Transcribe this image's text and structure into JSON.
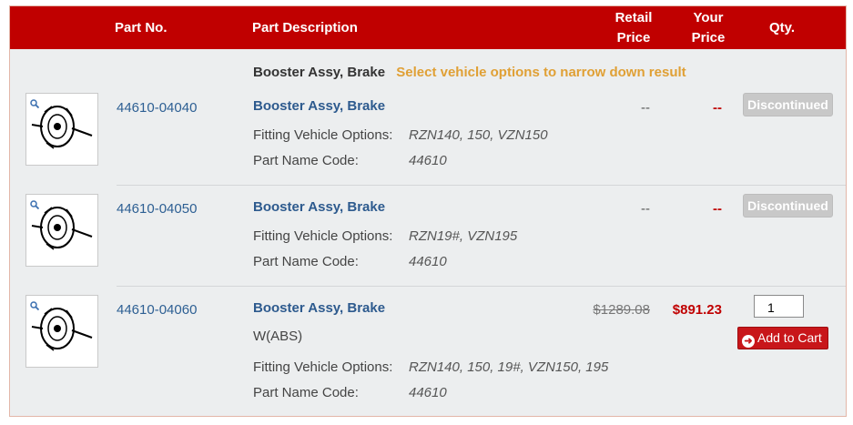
{
  "header": {
    "part_no": "Part No.",
    "part_description": "Part Description",
    "retail_price_l1": "Retail",
    "retail_price_l2": "Price",
    "your_price_l1": "Your",
    "your_price_l2": "Price",
    "qty": "Qty."
  },
  "group": {
    "title": "Booster Assy, Brake",
    "hint": "Select vehicle options to narrow down result"
  },
  "labels": {
    "fitting": "Fitting Vehicle Options:",
    "name_code": "Part Name Code:"
  },
  "rows": [
    {
      "part_no": "44610-04040",
      "description": "Booster Assy, Brake",
      "fitting": "RZN140, 150, VZN150",
      "name_code": "44610",
      "retail": "--",
      "your": "--",
      "button": "Discontinued"
    },
    {
      "part_no": "44610-04050",
      "description": "Booster Assy, Brake",
      "fitting": "RZN19#, VZN195",
      "name_code": "44610",
      "retail": "--",
      "your": "--",
      "button": "Discontinued"
    },
    {
      "part_no": "44610-04060",
      "description": "Booster Assy, Brake",
      "note": "W(ABS)",
      "fitting": "RZN140, 150, 19#, VZN150, 195",
      "name_code": "44610",
      "retail": "$1289.08",
      "your": "$891.23",
      "qty": "1",
      "button": "Add to Cart"
    }
  ],
  "colors": {
    "header": "#c00000",
    "link": "#2d5f93",
    "hint": "#e0a035",
    "price": "#c00000"
  }
}
